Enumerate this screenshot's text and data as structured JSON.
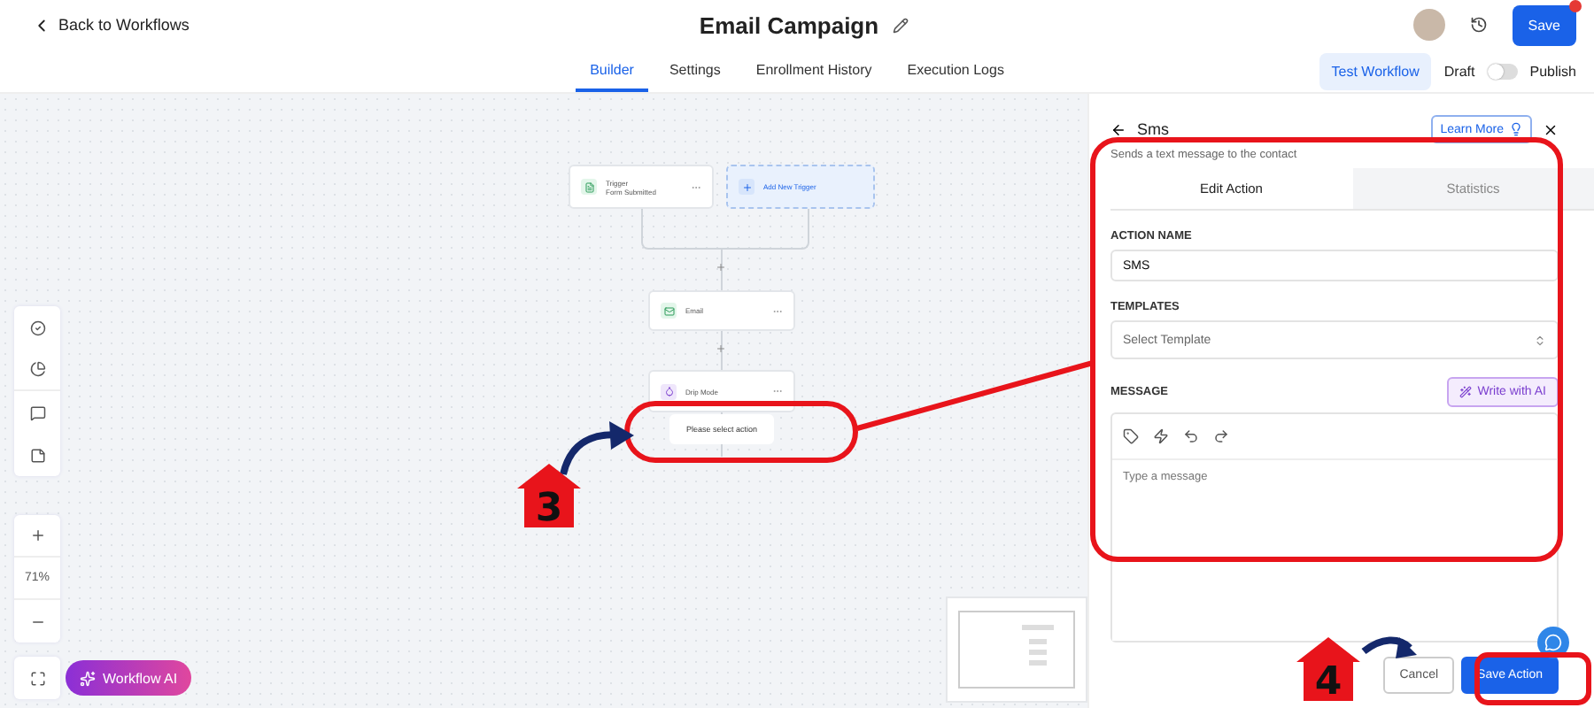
{
  "header": {
    "back_link": "Back to Workflows",
    "title": "Email Campaign",
    "save_button": "Save",
    "notification": true
  },
  "tabs": [
    {
      "label": "Builder",
      "selected": true
    },
    {
      "label": "Settings",
      "selected": false
    },
    {
      "label": "Enrollment History",
      "selected": false
    },
    {
      "label": "Execution Logs",
      "selected": false
    }
  ],
  "test_button": "Test Workflow",
  "publish_toggle": {
    "off_label": "Draft",
    "on_label": "Publish",
    "on": false
  },
  "canvas": {
    "nodes": [
      {
        "kind": "trigger",
        "title": "Trigger",
        "subtitle": "Form Submitted"
      },
      {
        "kind": "add",
        "title": "Add New Trigger"
      },
      {
        "kind": "email",
        "title": "Email"
      },
      {
        "kind": "drip",
        "title": "Drip Mode"
      },
      {
        "kind": "placeholder",
        "title": "Please select action"
      }
    ],
    "zoom": "71%",
    "ai_button": "Workflow AI"
  },
  "panel": {
    "title": "Sms",
    "learn_more": "Learn More",
    "description": "Sends a text message to the contact",
    "tabs": [
      {
        "label": "Edit Action",
        "selected": true
      },
      {
        "label": "Statistics",
        "selected": false
      }
    ],
    "fields": [
      {
        "kind": "text",
        "label": "ACTION NAME",
        "value": "SMS"
      },
      {
        "kind": "select",
        "label": "TEMPLATES",
        "placeholder": "Select Template"
      }
    ],
    "message": {
      "label": "MESSAGE",
      "ai_button": "Write with AI",
      "placeholder": "Type a message"
    },
    "buttons": [
      {
        "label": "Cancel",
        "primary": false
      },
      {
        "label": "Save Action",
        "primary": true
      }
    ]
  },
  "annotations": [
    {
      "kind": "step",
      "number": "3"
    },
    {
      "kind": "step",
      "number": "4"
    }
  ]
}
